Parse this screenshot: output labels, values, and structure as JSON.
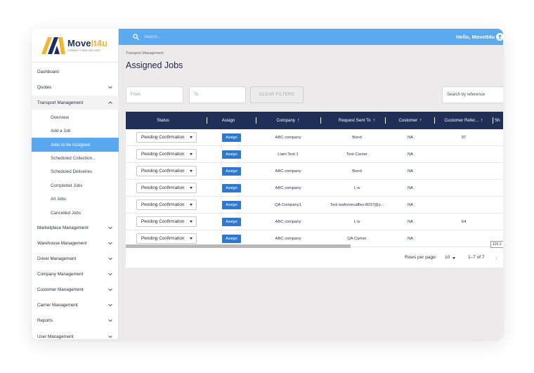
{
  "brand": {
    "name_part1": "Move",
    "name_part2": "It4u",
    "tagline": "CONNECT AND DELIVER",
    "colors": {
      "navy": "#1f2f5c",
      "gold": "#f2b632"
    }
  },
  "header": {
    "search_placeholder": "Search...",
    "greeting": "Hello, MoveIt4u",
    "search_icon": "search-icon",
    "user_icon": "account-circle-icon"
  },
  "sidebar": {
    "items": [
      {
        "label": "Dashboard",
        "expandable": false
      },
      {
        "label": "Quotes",
        "expandable": true
      },
      {
        "label": "Transport Management",
        "expandable": true,
        "open": true
      },
      {
        "label": "Overview",
        "sub": true
      },
      {
        "label": "Add a Job",
        "sub": true
      },
      {
        "label": "Jobs to be Assigned",
        "sub": true,
        "active": true
      },
      {
        "label": "Scheduled Collection...",
        "sub": true
      },
      {
        "label": "Scheduled Deliveries",
        "sub": true
      },
      {
        "label": "Completed Jobs",
        "sub": true
      },
      {
        "label": "All Jobs",
        "sub": true
      },
      {
        "label": "Cancelled Jobs",
        "sub": true
      },
      {
        "label": "Marketplace Management",
        "expandable": true
      },
      {
        "label": "Warehouse Management",
        "expandable": true
      },
      {
        "label": "Driver Management",
        "expandable": true
      },
      {
        "label": "Company Management",
        "expandable": true
      },
      {
        "label": "Customer Management",
        "expandable": true
      },
      {
        "label": "Carrier Management",
        "expandable": true
      },
      {
        "label": "Reports",
        "expandable": true
      },
      {
        "label": "User Management",
        "expandable": true
      }
    ]
  },
  "main": {
    "breadcrumb": "Transport Management",
    "title": "Assigned Jobs",
    "filters": {
      "from_placeholder": "From",
      "to_placeholder": "To",
      "clear_label": "CLEAR FILTERS",
      "reference_placeholder": "Search by reference"
    }
  },
  "table": {
    "columns": [
      {
        "label": "Status",
        "sortable": false
      },
      {
        "label": "Assign",
        "sortable": false
      },
      {
        "label": "Company",
        "sortable": true
      },
      {
        "label": "Request Sent To",
        "sortable": true
      },
      {
        "label": "Customer",
        "sortable": true
      },
      {
        "label": "Customer Refer...",
        "sortable": true
      },
      {
        "label": "Sh",
        "sortable": false
      }
    ],
    "rows": [
      {
        "status": "Pending Confirmation",
        "assign": "Assign",
        "company": "ABC company",
        "request_sent_to": "Bond",
        "customer": "NA",
        "customer_ref": "97"
      },
      {
        "status": "Pending Confirmation",
        "assign": "Assign",
        "company": "Liam Test 1",
        "request_sent_to": "Test Carrier",
        "customer": "NA",
        "customer_ref": ""
      },
      {
        "status": "Pending Confirmation",
        "assign": "Assign",
        "company": "ABC company",
        "request_sent_to": "Bond",
        "customer": "NA",
        "customer_ref": ""
      },
      {
        "status": "Pending Confirmation",
        "assign": "Assign",
        "company": "ABC company",
        "request_sent_to": "L w",
        "customer": "NA",
        "customer_ref": ""
      },
      {
        "status": "Pending Confirmation",
        "assign": "Assign",
        "company": "QA Company1",
        "request_sent_to": "Test wafrexecaffeu-8037@y...",
        "customer": "NA",
        "customer_ref": ""
      },
      {
        "status": "Pending Confirmation",
        "assign": "Assign",
        "company": "ABC company",
        "request_sent_to": "L w",
        "customer": "NA",
        "customer_ref": "64"
      },
      {
        "status": "Pending Confirmation",
        "assign": "Assign",
        "company": "ABC company",
        "request_sent_to": "QA Carrier",
        "customer": "NA",
        "customer_ref": ""
      }
    ],
    "cell_tooltip": "115.2"
  },
  "pagination": {
    "rows_per_page_label": "Rows per page:",
    "rows_per_page_value": "10",
    "range_text": "1–7 of 7"
  }
}
